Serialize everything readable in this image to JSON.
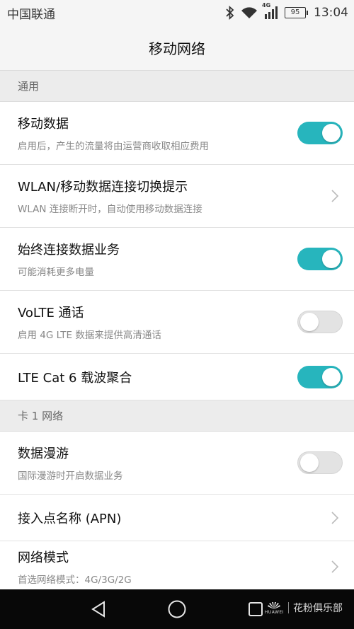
{
  "status_bar": {
    "carrier": "中国联通",
    "network_type": "4G",
    "battery": "95",
    "time": "13:04",
    "icons": [
      "bluetooth-icon",
      "wifi-icon",
      "signal-icon"
    ]
  },
  "title": "移动网络",
  "sections": {
    "general": {
      "header": "通用",
      "items": [
        {
          "title": "移动数据",
          "subtitle": "启用后，产生的流量将由运营商收取相应费用",
          "control": "toggle",
          "on": true
        },
        {
          "title": "WLAN/移动数据连接切换提示",
          "subtitle": "WLAN 连接断开时，自动使用移动数据连接",
          "control": "chevron"
        },
        {
          "title": "始终连接数据业务",
          "subtitle": "可能消耗更多电量",
          "control": "toggle",
          "on": true
        },
        {
          "title": "VoLTE 通话",
          "subtitle": "启用 4G LTE 数据来提供高清通话",
          "control": "toggle",
          "on": false
        },
        {
          "title": "LTE Cat 6 载波聚合",
          "subtitle": "",
          "control": "toggle",
          "on": true
        }
      ]
    },
    "card1": {
      "header": "卡 1 网络",
      "items": [
        {
          "title": "数据漫游",
          "subtitle": "国际漫游时开启数据业务",
          "control": "toggle",
          "on": false
        },
        {
          "title": "接入点名称 (APN)",
          "subtitle": "",
          "control": "chevron"
        },
        {
          "title": "网络模式",
          "subtitle": "首选网络模式：4G/3G/2G",
          "control": "chevron"
        }
      ]
    }
  },
  "nav_bar": {
    "buttons": [
      "back-icon",
      "home-icon",
      "recents-icon"
    ],
    "brand_logo_text": "HUAWEI",
    "brand_text": "花粉俱乐部"
  },
  "colors": {
    "toggle_on": "#27b5bd",
    "toggle_off": "#e3e3e3",
    "nav_background": "#080808"
  }
}
